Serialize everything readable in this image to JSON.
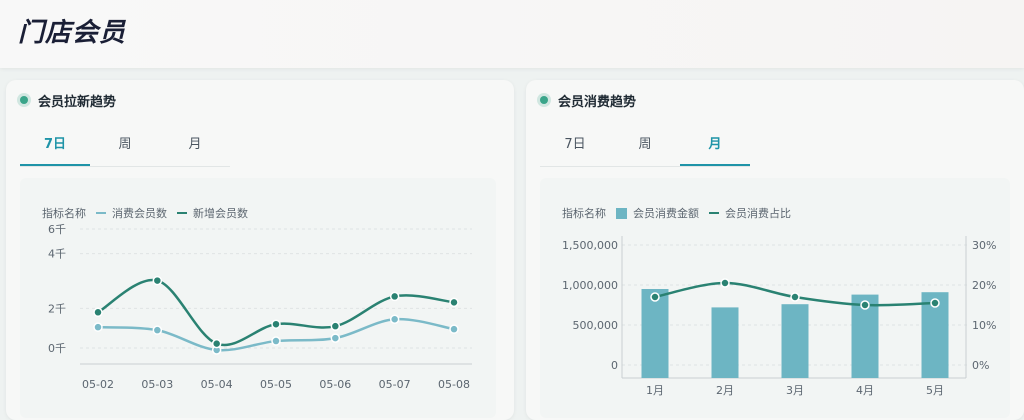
{
  "page": {
    "title": "门店会员"
  },
  "left_card": {
    "title": "会员拉新趋势",
    "tabs": [
      "7日",
      "周",
      "月"
    ],
    "active_tab": 0,
    "legend": {
      "prefix": "指标名称",
      "items": [
        "消费会员数",
        "新增会员数"
      ]
    }
  },
  "right_card": {
    "title": "会员消费趋势",
    "tabs": [
      "7日",
      "周",
      "月"
    ],
    "active_tab": 2,
    "legend": {
      "prefix": "指标名称",
      "items": [
        "会员消费金额",
        "会员消费占比"
      ]
    }
  },
  "colors": {
    "accent": "#1f94a8",
    "dark_teal": "#2a8272",
    "light_teal": "#7bbac8",
    "bar": "#6db5c3"
  },
  "chart_data": [
    {
      "type": "line",
      "x": [
        "05-02",
        "05-03",
        "05-04",
        "05-05",
        "05-06",
        "05-07",
        "05-08"
      ],
      "y_ticks": [
        "6千",
        "4千",
        "2千",
        "0千"
      ],
      "ylim": [
        0,
        6000
      ],
      "series": [
        {
          "name": "消费会员数",
          "values": [
            1050,
            900,
            -100,
            350,
            500,
            1450,
            950
          ],
          "color": "#7bbac8"
        },
        {
          "name": "新增会员数",
          "values": [
            1800,
            3400,
            220,
            1200,
            1100,
            2600,
            2300
          ],
          "color": "#2a8272"
        }
      ],
      "grid": true,
      "legend_position": "top-left"
    },
    {
      "type": "bar",
      "categories": [
        "1月",
        "2月",
        "3月",
        "4月",
        "5月"
      ],
      "y_ticks": [
        "1,500,000",
        "1,000,000",
        "500,000",
        "0"
      ],
      "y2_ticks": [
        "30%",
        "20%",
        "10%",
        "0%"
      ],
      "ylim": [
        0,
        1500000
      ],
      "y2lim": [
        0,
        0.3
      ],
      "series": [
        {
          "name": "会员消费金额",
          "type": "bar",
          "values": [
            950000,
            720000,
            760000,
            880000,
            910000
          ],
          "axis": "left",
          "color": "#6db5c3"
        },
        {
          "name": "会员消费占比",
          "type": "line",
          "values": [
            0.17,
            0.205,
            0.17,
            0.15,
            0.155
          ],
          "axis": "right",
          "color": "#2a8272"
        }
      ],
      "grid": true,
      "legend_position": "top-left"
    }
  ]
}
